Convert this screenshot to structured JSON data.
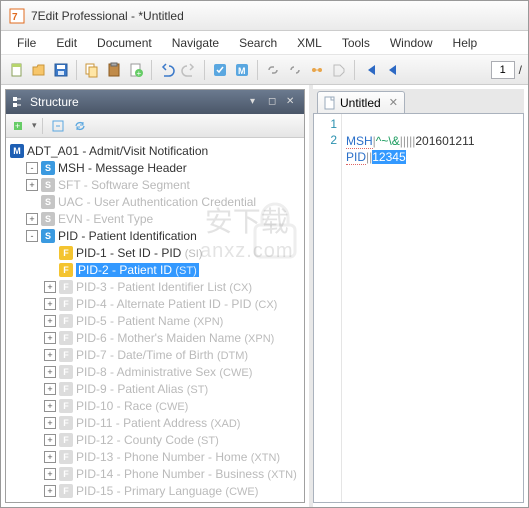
{
  "title": "7Edit Professional - *Untitled",
  "menu": [
    "File",
    "Edit",
    "Document",
    "Navigate",
    "Search",
    "XML",
    "Tools",
    "Window",
    "Help"
  ],
  "page_current": "1",
  "page_sep": "/",
  "structure": {
    "title": "Structure",
    "root": "ADT_A01 - Admit/Visit Notification",
    "items": [
      {
        "toggle": "-",
        "icon": "s",
        "label": "MSH",
        "desc": " - Message Header",
        "dim": false
      },
      {
        "toggle": "+",
        "icon": "s-gray",
        "label": "SFT",
        "desc": " - Software Segment",
        "dim": true
      },
      {
        "toggle": "",
        "icon": "s-gray",
        "label": "UAC",
        "desc": " - User Authentication Credential",
        "dim": true
      },
      {
        "toggle": "+",
        "icon": "s-gray",
        "label": "EVN",
        "desc": " - Event Type",
        "dim": true
      },
      {
        "toggle": "-",
        "icon": "s",
        "label": "PID",
        "desc": " - Patient Identification",
        "dim": false
      }
    ],
    "pid_fields": [
      {
        "toggle": "",
        "icon": "f",
        "label": "PID-1 - Set ID - PID",
        "suffix": "(SI)",
        "dim": false,
        "sel": false
      },
      {
        "toggle": "",
        "icon": "f",
        "label": "PID-2 - Patient ID",
        "suffix": "(ST)",
        "dim": false,
        "sel": true
      },
      {
        "toggle": "+",
        "icon": "f-gray",
        "label": "PID-3 - Patient Identifier List",
        "suffix": "(CX)",
        "dim": true,
        "sel": false
      },
      {
        "toggle": "+",
        "icon": "f-gray",
        "label": "PID-4 - Alternate Patient ID - PID",
        "suffix": "(CX)",
        "dim": true,
        "sel": false
      },
      {
        "toggle": "+",
        "icon": "f-gray",
        "label": "PID-5 - Patient Name",
        "suffix": "(XPN)",
        "dim": true,
        "sel": false
      },
      {
        "toggle": "+",
        "icon": "f-gray",
        "label": "PID-6 - Mother's Maiden Name",
        "suffix": "(XPN)",
        "dim": true,
        "sel": false
      },
      {
        "toggle": "+",
        "icon": "f-gray",
        "label": "PID-7 - Date/Time of Birth",
        "suffix": "(DTM)",
        "dim": true,
        "sel": false
      },
      {
        "toggle": "+",
        "icon": "f-gray",
        "label": "PID-8 - Administrative Sex",
        "suffix": "(CWE)",
        "dim": true,
        "sel": false
      },
      {
        "toggle": "+",
        "icon": "f-gray",
        "label": "PID-9 - Patient Alias",
        "suffix": "(ST)",
        "dim": true,
        "sel": false
      },
      {
        "toggle": "+",
        "icon": "f-gray",
        "label": "PID-10 - Race",
        "suffix": "(CWE)",
        "dim": true,
        "sel": false
      },
      {
        "toggle": "+",
        "icon": "f-gray",
        "label": "PID-11 - Patient Address",
        "suffix": "(XAD)",
        "dim": true,
        "sel": false
      },
      {
        "toggle": "+",
        "icon": "f-gray",
        "label": "PID-12 - County Code",
        "suffix": "(ST)",
        "dim": true,
        "sel": false
      },
      {
        "toggle": "+",
        "icon": "f-gray",
        "label": "PID-13 - Phone Number - Home",
        "suffix": "(XTN)",
        "dim": true,
        "sel": false
      },
      {
        "toggle": "+",
        "icon": "f-gray",
        "label": "PID-14 - Phone Number - Business",
        "suffix": "(XTN)",
        "dim": true,
        "sel": false
      },
      {
        "toggle": "+",
        "icon": "f-gray",
        "label": "PID-15 - Primary Language",
        "suffix": "(CWE)",
        "dim": true,
        "sel": false
      }
    ]
  },
  "editor": {
    "tab_label": "Untitled",
    "lines": {
      "n1": "1",
      "n2": "2"
    },
    "l1_seg": "MSH",
    "l1_delim1": "|",
    "l1_enc": "^~\\&",
    "l1_delim2": "|||||",
    "l1_txt": "201601211",
    "l2_seg": "PID",
    "l2_delim": "||",
    "l2_sel": "12345"
  },
  "watermark": {
    "line1": "安下载",
    "line2": "anxz.com"
  }
}
